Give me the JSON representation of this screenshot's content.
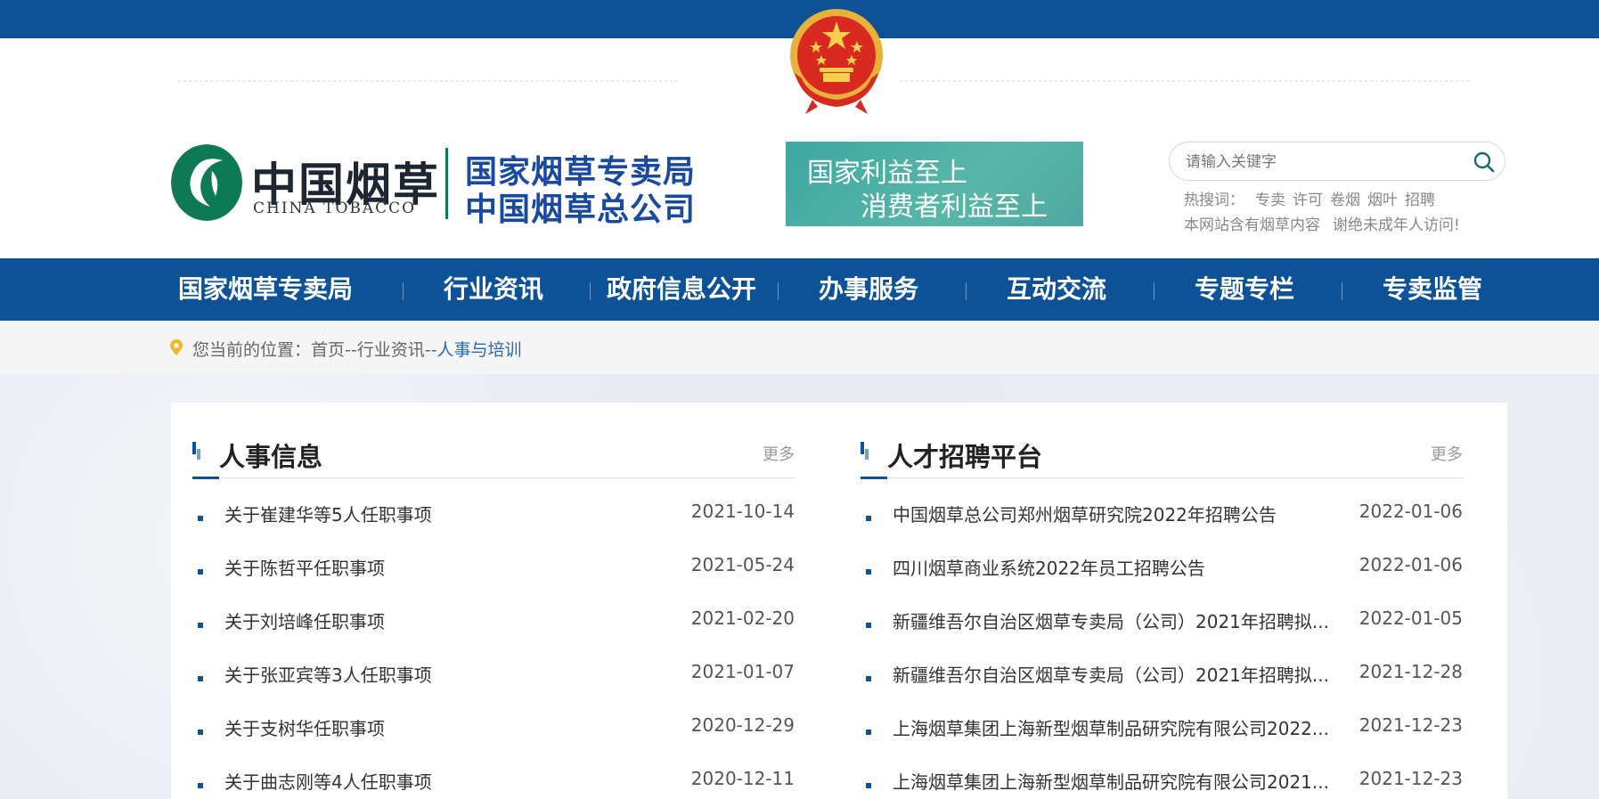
{
  "header": {
    "logo_cn": "中国烟草",
    "logo_en": "CHINA TOBACCO",
    "org_line1": "国家烟草专卖局",
    "org_line2": "中国烟草总公司",
    "slogan_line1": "国家利益至上",
    "slogan_line2": "消费者利益至上",
    "search_placeholder": "请输入关键字",
    "hot_label": "热搜词：",
    "hot_words": [
      "专卖",
      "许可",
      "卷烟",
      "烟叶",
      "招聘"
    ],
    "notice_part1": "本网站含有烟草内容",
    "notice_part2": "谢绝未成年人访问!"
  },
  "nav": {
    "items": [
      "国家烟草专卖局",
      "行业资讯",
      "政府信息公开",
      "办事服务",
      "互动交流",
      "专题专栏",
      "专卖监管"
    ]
  },
  "breadcrumb": {
    "label": "您当前的位置：",
    "home": "首页",
    "sep": "--",
    "level2": "行业资讯",
    "current": "人事与培训"
  },
  "columns": [
    {
      "title": "人事信息",
      "more": "更多",
      "rows": [
        {
          "title": "关于崔建华等5人任职事项",
          "date": "2021-10-14"
        },
        {
          "title": "关于陈哲平任职事项",
          "date": "2021-05-24"
        },
        {
          "title": "关于刘培峰任职事项",
          "date": "2021-02-20"
        },
        {
          "title": "关于张亚宾等3人任职事项",
          "date": "2021-01-07"
        },
        {
          "title": "关于支树华任职事项",
          "date": "2020-12-29"
        },
        {
          "title": "关于曲志刚等4人任职事项",
          "date": "2020-12-11"
        }
      ]
    },
    {
      "title": "人才招聘平台",
      "more": "更多",
      "rows": [
        {
          "title": "中国烟草总公司郑州烟草研究院2022年招聘公告",
          "date": "2022-01-06"
        },
        {
          "title": "四川烟草商业系统2022年员工招聘公告",
          "date": "2022-01-06"
        },
        {
          "title": "新疆维吾尔自治区烟草专卖局（公司）2021年招聘拟...",
          "date": "2022-01-05"
        },
        {
          "title": "新疆维吾尔自治区烟草专卖局（公司）2021年招聘拟...",
          "date": "2021-12-28"
        },
        {
          "title": "上海烟草集团上海新型烟草制品研究院有限公司2022...",
          "date": "2021-12-23"
        },
        {
          "title": "上海烟草集团上海新型烟草制品研究院有限公司2021...",
          "date": "2021-12-23"
        }
      ]
    }
  ]
}
